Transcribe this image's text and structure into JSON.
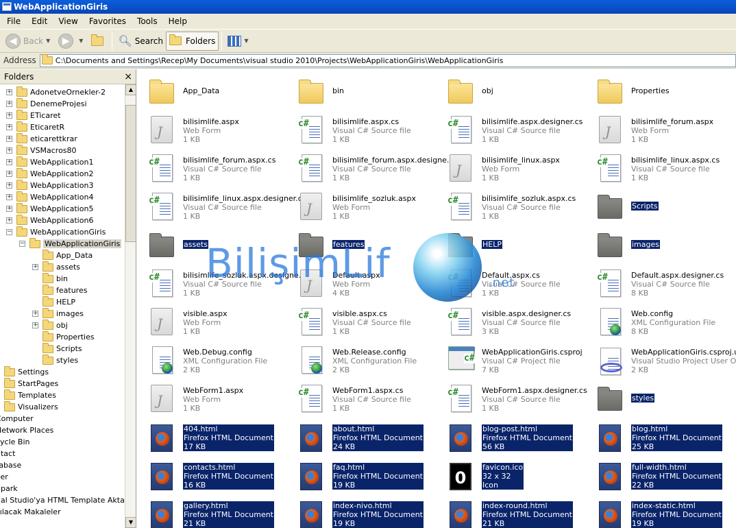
{
  "window": {
    "title": "WebApplicationGiris"
  },
  "menu": [
    "File",
    "Edit",
    "View",
    "Favorites",
    "Tools",
    "Help"
  ],
  "toolbar": {
    "back": "Back",
    "search": "Search",
    "folders": "Folders"
  },
  "address": {
    "label": "Address",
    "path": "C:\\Documents and Settings\\Recep\\My Documents\\visual studio 2010\\Projects\\WebApplicationGiris\\WebApplicationGiris"
  },
  "folders_pane": {
    "title": "Folders",
    "close": "×",
    "tree": [
      {
        "label": "AdonetveOrnekler-2",
        "level": 1,
        "pm": "+"
      },
      {
        "label": "DenemeProjesi",
        "level": 1,
        "pm": "+"
      },
      {
        "label": "ETicaret",
        "level": 1,
        "pm": "+"
      },
      {
        "label": "EticaretR",
        "level": 1,
        "pm": "+"
      },
      {
        "label": "eticarettkrar",
        "level": 1,
        "pm": "+"
      },
      {
        "label": "VSMacros80",
        "level": 1,
        "pm": "+"
      },
      {
        "label": "WebApplication1",
        "level": 1,
        "pm": "+"
      },
      {
        "label": "WebApplication2",
        "level": 1,
        "pm": "+"
      },
      {
        "label": "WebApplication3",
        "level": 1,
        "pm": "+"
      },
      {
        "label": "WebApplication4",
        "level": 1,
        "pm": "+"
      },
      {
        "label": "WebApplication5",
        "level": 1,
        "pm": "+"
      },
      {
        "label": "WebApplication6",
        "level": 1,
        "pm": "+"
      },
      {
        "label": "WebApplicationGiris",
        "level": 1,
        "pm": "-"
      },
      {
        "label": "WebApplicationGiris",
        "level": 2,
        "pm": "-",
        "selected": true
      },
      {
        "label": "App_Data",
        "level": 3,
        "pm": ""
      },
      {
        "label": "assets",
        "level": 3,
        "pm": "+"
      },
      {
        "label": "bin",
        "level": 3,
        "pm": ""
      },
      {
        "label": "features",
        "level": 3,
        "pm": ""
      },
      {
        "label": "HELP",
        "level": 3,
        "pm": ""
      },
      {
        "label": "images",
        "level": 3,
        "pm": "+"
      },
      {
        "label": "obj",
        "level": 3,
        "pm": "+"
      },
      {
        "label": "Properties",
        "level": 3,
        "pm": ""
      },
      {
        "label": "Scripts",
        "level": 3,
        "pm": ""
      },
      {
        "label": "styles",
        "level": 3,
        "pm": ""
      },
      {
        "label": "Settings",
        "level": 0,
        "pm": ""
      },
      {
        "label": "StartPages",
        "level": 0,
        "pm": ""
      },
      {
        "label": "Templates",
        "level": 0,
        "pm": ""
      },
      {
        "label": "Visualizers",
        "level": 0,
        "pm": ""
      },
      {
        "label": "Computer",
        "level": -1,
        "pm": ""
      },
      {
        "label": "Network Places",
        "level": -1,
        "pm": ""
      },
      {
        "label": "cycle Bin",
        "level": -1,
        "pm": ""
      },
      {
        "label": "ntact",
        "level": -1,
        "pm": ""
      },
      {
        "label": "tabase",
        "level": -1,
        "pm": ""
      },
      {
        "label": "ver",
        "level": -1,
        "pm": ""
      },
      {
        "label": "dpark",
        "level": -1,
        "pm": ""
      },
      {
        "label": "ual Studio'ya HTML Template Aktarımı",
        "level": -1,
        "pm": ""
      },
      {
        "label": "zılacak Makaleler",
        "level": -1,
        "pm": ""
      }
    ]
  },
  "files": [
    {
      "name": "App_Data",
      "type": "",
      "size": "",
      "icon": "folder",
      "sel": false
    },
    {
      "name": "bin",
      "type": "",
      "size": "",
      "icon": "folder",
      "sel": false
    },
    {
      "name": "obj",
      "type": "",
      "size": "",
      "icon": "folder",
      "sel": false
    },
    {
      "name": "Properties",
      "type": "",
      "size": "",
      "icon": "folder",
      "sel": false
    },
    {
      "name": "bilisimlife.aspx",
      "type": "Web Form",
      "size": "1 KB",
      "icon": "aspx",
      "sel": false
    },
    {
      "name": "bilisimlife.aspx.cs",
      "type": "Visual C# Source file",
      "size": "1 KB",
      "icon": "cs",
      "sel": false
    },
    {
      "name": "bilisimlife.aspx.designer.cs",
      "type": "Visual C# Source file",
      "size": "1 KB",
      "icon": "cs",
      "sel": false
    },
    {
      "name": "bilisimlife_forum.aspx",
      "type": "Web Form",
      "size": "1 KB",
      "icon": "aspx",
      "sel": false
    },
    {
      "name": "bilisimlife_forum.aspx.cs",
      "type": "Visual C# Source file",
      "size": "1 KB",
      "icon": "cs",
      "sel": false
    },
    {
      "name": "bilisimlife_forum.aspx.designe...",
      "type": "Visual C# Source file",
      "size": "1 KB",
      "icon": "cs",
      "sel": false
    },
    {
      "name": "bilisimlife_linux.aspx",
      "type": "Web Form",
      "size": "1 KB",
      "icon": "aspx",
      "sel": false
    },
    {
      "name": "bilisimlife_linux.aspx.cs",
      "type": "Visual C# Source file",
      "size": "1 KB",
      "icon": "cs",
      "sel": false
    },
    {
      "name": "bilisimlife_linux.aspx.designer.cs",
      "type": "Visual C# Source file",
      "size": "1 KB",
      "icon": "cs",
      "sel": false
    },
    {
      "name": "bilisimlife_sozluk.aspx",
      "type": "Web Form",
      "size": "1 KB",
      "icon": "aspx",
      "sel": false
    },
    {
      "name": "bilisimlife_sozluk.aspx.cs",
      "type": "Visual C# Source file",
      "size": "1 KB",
      "icon": "cs",
      "sel": false
    },
    {
      "name": "Scripts",
      "type": "",
      "size": "",
      "icon": "folder-dark",
      "sel": true
    },
    {
      "name": "assets",
      "type": "",
      "size": "",
      "icon": "folder-dark",
      "sel": true
    },
    {
      "name": "features",
      "type": "",
      "size": "",
      "icon": "folder-dark",
      "sel": true
    },
    {
      "name": "HELP",
      "type": "",
      "size": "",
      "icon": "folder-dark",
      "sel": true
    },
    {
      "name": "images",
      "type": "",
      "size": "",
      "icon": "folder-dark",
      "sel": true
    },
    {
      "name": "bilisimlife_sozluk.aspx.designe...",
      "type": "Visual C# Source file",
      "size": "1 KB",
      "icon": "cs",
      "sel": false
    },
    {
      "name": "Default.aspx",
      "type": "Web Form",
      "size": "4 KB",
      "icon": "aspx",
      "sel": false
    },
    {
      "name": "Default.aspx.cs",
      "type": "Visual C# Source file",
      "size": "1 KB",
      "icon": "cs",
      "sel": false
    },
    {
      "name": "Default.aspx.designer.cs",
      "type": "Visual C# Source file",
      "size": "8 KB",
      "icon": "cs",
      "sel": false
    },
    {
      "name": "visible.aspx",
      "type": "Web Form",
      "size": "1 KB",
      "icon": "aspx",
      "sel": false
    },
    {
      "name": "visible.aspx.cs",
      "type": "Visual C# Source file",
      "size": "1 KB",
      "icon": "cs",
      "sel": false
    },
    {
      "name": "visible.aspx.designer.cs",
      "type": "Visual C# Source file",
      "size": "3 KB",
      "icon": "cs",
      "sel": false
    },
    {
      "name": "Web.config",
      "type": "XML Configuration File",
      "size": "8 KB",
      "icon": "config",
      "sel": false
    },
    {
      "name": "Web.Debug.config",
      "type": "XML Configuration File",
      "size": "2 KB",
      "icon": "config",
      "sel": false
    },
    {
      "name": "Web.Release.config",
      "type": "XML Configuration File",
      "size": "2 KB",
      "icon": "config",
      "sel": false
    },
    {
      "name": "WebApplicationGiris.csproj",
      "type": "Visual C# Project file",
      "size": "7 KB",
      "icon": "proj",
      "sel": false
    },
    {
      "name": "WebApplicationGiris.csproj.user",
      "type": "Visual Studio Project User Opti...",
      "size": "2 KB",
      "icon": "user",
      "sel": false
    },
    {
      "name": "WebForm1.aspx",
      "type": "Web Form",
      "size": "1 KB",
      "icon": "aspx",
      "sel": false
    },
    {
      "name": "WebForm1.aspx.cs",
      "type": "Visual C# Source file",
      "size": "1 KB",
      "icon": "cs",
      "sel": false
    },
    {
      "name": "WebForm1.aspx.designer.cs",
      "type": "Visual C# Source file",
      "size": "1 KB",
      "icon": "cs",
      "sel": false
    },
    {
      "name": "styles",
      "type": "",
      "size": "",
      "icon": "folder-dark",
      "sel": true
    },
    {
      "name": "404.html",
      "type": "Firefox HTML Document",
      "size": "17 KB",
      "icon": "fx",
      "sel": true
    },
    {
      "name": "about.html",
      "type": "Firefox HTML Document",
      "size": "24 KB",
      "icon": "fx",
      "sel": true
    },
    {
      "name": "blog-post.html",
      "type": "Firefox HTML Document",
      "size": "56 KB",
      "icon": "fx",
      "sel": true
    },
    {
      "name": "blog.html",
      "type": "Firefox HTML Document",
      "size": "25 KB",
      "icon": "fx",
      "sel": true
    },
    {
      "name": "contacts.html",
      "type": "Firefox HTML Document",
      "size": "16 KB",
      "icon": "fx",
      "sel": true
    },
    {
      "name": "faq.html",
      "type": "Firefox HTML Document",
      "size": "19 KB",
      "icon": "fx",
      "sel": true
    },
    {
      "name": "favicon.ico",
      "type": "32 x 32",
      "size": "Icon",
      "icon": "ico",
      "sel": true
    },
    {
      "name": "full-width.html",
      "type": "Firefox HTML Document",
      "size": "22 KB",
      "icon": "fx",
      "sel": true
    },
    {
      "name": "gallery.html",
      "type": "Firefox HTML Document",
      "size": "21 KB",
      "icon": "fx",
      "sel": true
    },
    {
      "name": "index-nivo.html",
      "type": "Firefox HTML Document",
      "size": "19 KB",
      "icon": "fx",
      "sel": true
    },
    {
      "name": "index-round.html",
      "type": "Firefox HTML Document",
      "size": "21 KB",
      "icon": "fx",
      "sel": true
    },
    {
      "name": "index-static.html",
      "type": "Firefox HTML Document",
      "size": "19 KB",
      "icon": "fx",
      "sel": true
    }
  ],
  "watermark": {
    "text": "BilişimLif",
    "suffix": ".net"
  }
}
